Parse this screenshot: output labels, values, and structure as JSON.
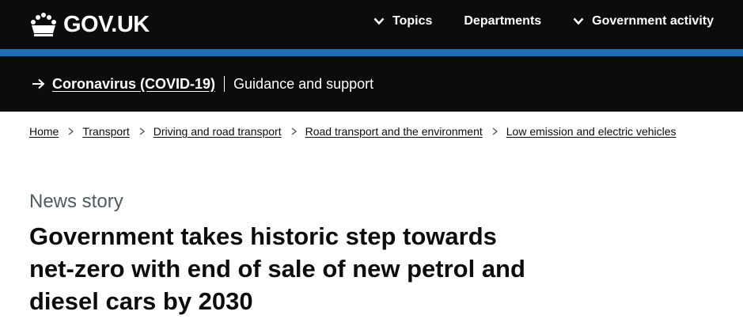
{
  "header": {
    "logo_text": "GOV.UK",
    "nav": [
      {
        "label": "Topics",
        "has_chevron": true,
        "icon": "chevron-down-icon"
      },
      {
        "label": "Departments",
        "has_chevron": false
      },
      {
        "label": "Government activity",
        "has_chevron": true,
        "icon": "chevron-down-icon"
      }
    ],
    "colors": {
      "background": "#0b0c0c",
      "stripe": "#1d70b8"
    }
  },
  "banner": {
    "link_text": "Coronavirus (COVID-19)",
    "text": "Guidance and support",
    "icon": "arrow-right-icon"
  },
  "breadcrumbs": [
    "Home",
    "Transport",
    "Driving and road transport",
    "Road transport and the environment",
    "Low emission and electric vehicles"
  ],
  "article": {
    "caption": "News story",
    "title": "Government takes historic step towards net-zero with end of sale of new petrol and diesel cars by 2030"
  }
}
